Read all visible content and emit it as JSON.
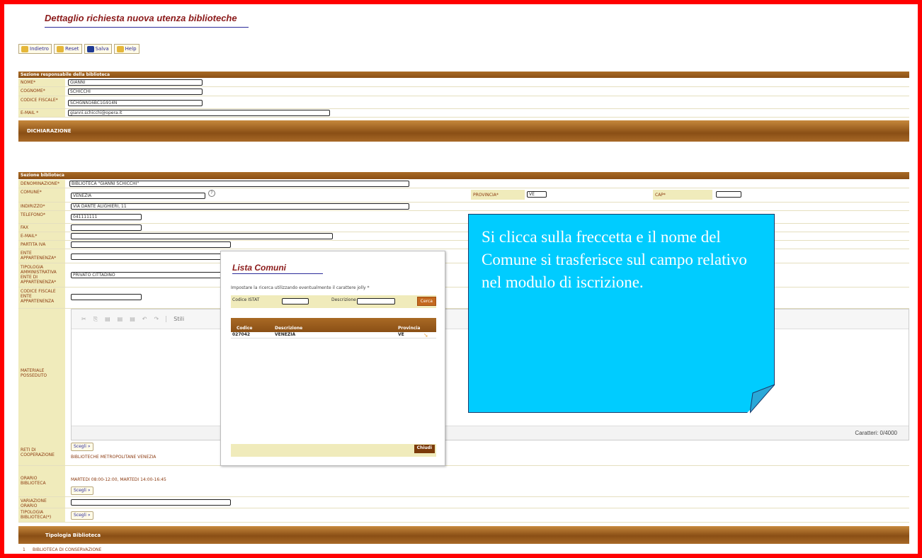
{
  "page": {
    "title": "Dettaglio richiesta nuova utenza biblioteche"
  },
  "toolbar": {
    "back": "Indietro",
    "reset": "Reset",
    "save": "Salva",
    "help": "Help"
  },
  "responsabile": {
    "header": "Sezione responsabile della biblioteca",
    "nome_label": "NOME*",
    "nome": "GIANNI",
    "cognome_label": "COGNOME*",
    "cognome": "SCHICCHI",
    "cf_label": "CODICE FISCALE*",
    "cf": "SCHGNN16BC1G914N",
    "email_label": "E-MAIL *",
    "email": "gianni.schicchi@opera.it"
  },
  "dichiarazione": {
    "header": "DICHIARAZIONE"
  },
  "biblioteca": {
    "header": "Sezione biblioteca",
    "denominazione_label": "DENOMINAZIONE*",
    "denominazione": "BIBLIOTECA \"GIANNI SCHICCHI\"",
    "comune_label": "COMUNE*",
    "comune": "VENEZIA",
    "provincia_label": "PROVINCIA*",
    "provincia": "VE",
    "cap_label": "CAP*",
    "cap": "",
    "indirizzo_label": "INDIRIZZO*",
    "indirizzo": "VIA DANTE ALIGHIERI, 11",
    "telefono_label": "TELEFONO*",
    "telefono": "041111111",
    "fax_label": "FAX",
    "email_label": "E-MAIL*",
    "piva_label": "PARTITA IVA",
    "ente_label": "ENTE APPARTENENZA*",
    "tipologia_amm_label": "TIPOLOGIA AMMINISTRATIVA ENTE DI APPARTENENZA*",
    "tipologia_amm": "PRIVATO CITTADINO",
    "cf_ente_label": "CODICE FISCALE ENTE APPARTENENZA",
    "materiale_label": "MATERIALE POSSEDUTO",
    "editor_style": "Stili",
    "counter": "Caratteri: 0/4000",
    "reti_label": "RETI DI COOPERAZIONE",
    "reti_value": "BIBLIOTECHE METROPOLITANE VENEZIA",
    "scegli": "Scegli »",
    "orario_label": "ORARIO BIBLIOTECA",
    "orario_value": "MARTEDI 08:00-12:00, MARTEDI 14:00-16:45",
    "variazione_label": "VARIAZIONE ORARIO",
    "tipologia_bib_label": "TIPOLOGIA BIBLIOTECA(*)"
  },
  "tipologia_table": {
    "header": "Tipologia Biblioteca",
    "row_num": "1",
    "row_value": "BIBLIOTECA DI CONSERVAZIONE"
  },
  "popup": {
    "title": "Lista Comuni",
    "hint": "Impostare la ricerca utilizzando eventualmente il carattere jolly *",
    "codice_label": "Codice ISTAT",
    "descrizione_label": "Descrizione",
    "cerca": "Cerca",
    "columns": [
      "Codice",
      "Descrizione",
      "Provincia"
    ],
    "row": {
      "codice": "027042",
      "descrizione": "VENEZIA",
      "provincia": "VE"
    },
    "chiudi": "Chiudi"
  },
  "callout": {
    "text": "Si clicca sulla freccetta  e il nome del Comune si trasferisce sul campo relativo nel modulo di iscrizione."
  },
  "colors": {
    "frame": "#ff0000",
    "header_brown": "#8a4f15",
    "label_bg": "#f0ebbb",
    "callout": "#00ccff"
  }
}
